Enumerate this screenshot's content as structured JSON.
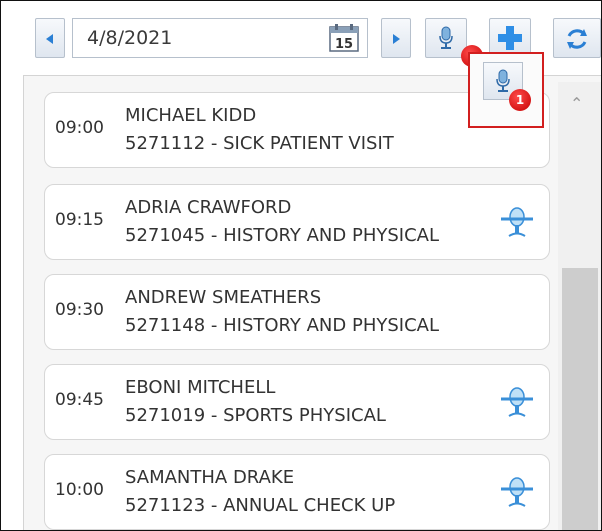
{
  "toolbar": {
    "date": "4/8/2021",
    "calendar_day": "15",
    "badge_1": "1"
  },
  "appointments": [
    {
      "time": "09:00",
      "name": "MICHAEL KIDD",
      "desc": "5271112 - SICK PATIENT VISIT",
      "has_mic": false
    },
    {
      "time": "09:15",
      "name": "ADRIA CRAWFORD",
      "desc": "5271045 - HISTORY AND PHYSICAL",
      "has_mic": true
    },
    {
      "time": "09:30",
      "name": "ANDREW SMEATHERS",
      "desc": "5271148 - HISTORY AND PHYSICAL",
      "has_mic": false
    },
    {
      "time": "09:45",
      "name": "EBONI MITCHELL",
      "desc": "5271019 - SPORTS PHYSICAL",
      "has_mic": true
    },
    {
      "time": "10:00",
      "name": "SAMANTHA DRAKE",
      "desc": "5271123 - ANNUAL CHECK UP",
      "has_mic": true
    }
  ],
  "colors": {
    "accent_blue": "#2a7fd4",
    "highlight_red": "#d21f1f",
    "mic_blue": "#3a8fd8"
  }
}
